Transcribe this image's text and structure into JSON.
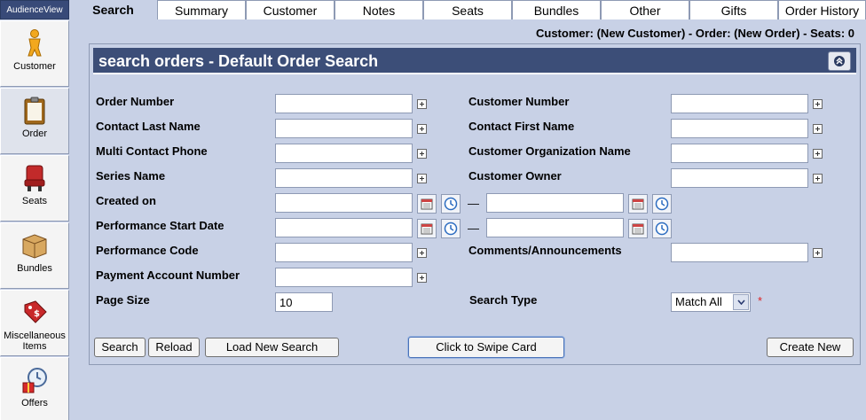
{
  "brand": "AudienceView",
  "sidebar": [
    {
      "id": "customer",
      "label": "Customer",
      "icon": "customer-icon"
    },
    {
      "id": "order",
      "label": "Order",
      "icon": "order-icon"
    },
    {
      "id": "seats",
      "label": "Seats",
      "icon": "seats-icon"
    },
    {
      "id": "bundles",
      "label": "Bundles",
      "icon": "bundles-icon"
    },
    {
      "id": "misc",
      "label": "Miscellaneous Items",
      "icon": "price-tag-icon"
    },
    {
      "id": "offers",
      "label": "Offers",
      "icon": "offers-icon"
    }
  ],
  "tabs": [
    "Search",
    "Summary",
    "Customer",
    "Notes",
    "Seats",
    "Bundles",
    "Other",
    "Gifts",
    "Order History"
  ],
  "status": "Customer: (New Customer) - Order: (New Order) - Seats: 0",
  "panel": {
    "title": "search orders - Default Order Search"
  },
  "fields": {
    "order_number": "Order Number",
    "contact_last_name": "Contact Last Name",
    "multi_contact_phone": "Multi Contact Phone",
    "series_name": "Series Name",
    "created_on": "Created on",
    "performance_start_date": "Performance Start Date",
    "performance_code": "Performance Code",
    "payment_account_number": "Payment Account Number",
    "page_size": "Page Size",
    "page_size_value": "10",
    "customer_number": "Customer Number",
    "contact_first_name": "Contact First Name",
    "customer_org_name": "Customer Organization Name",
    "customer_owner": "Customer Owner",
    "comments": "Comments/Announcements",
    "search_type": "Search Type",
    "search_type_value": "Match All",
    "required_mark": "*",
    "range_dash": "—"
  },
  "buttons": {
    "search": "Search",
    "reload": "Reload",
    "load_new_search": "Load New Search",
    "swipe_card": "Click to Swipe Card",
    "create_new": "Create New"
  }
}
